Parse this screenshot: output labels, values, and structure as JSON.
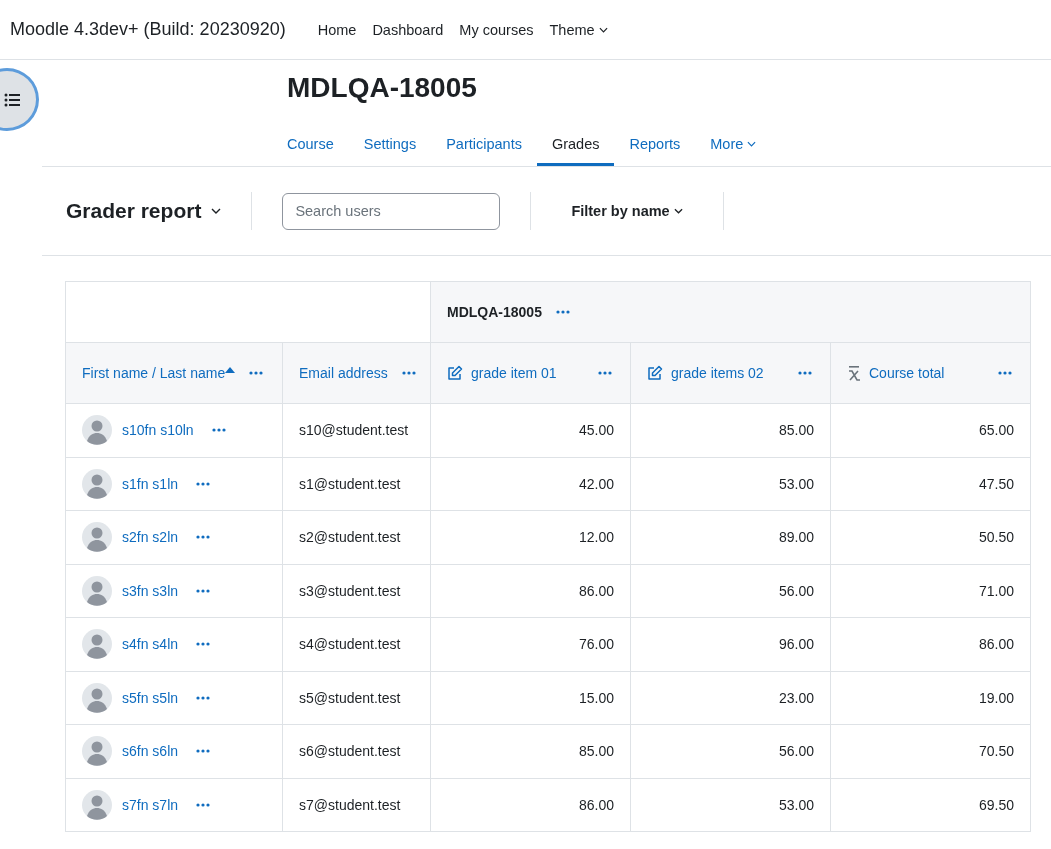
{
  "site_title": "Moodle 4.3dev+ (Build: 20230920)",
  "nav": [
    {
      "label": "Home",
      "dropdown": false
    },
    {
      "label": "Dashboard",
      "dropdown": false
    },
    {
      "label": "My courses",
      "dropdown": false
    },
    {
      "label": "Theme",
      "dropdown": true
    }
  ],
  "course_title": "MDLQA-18005",
  "tabs": [
    {
      "label": "Course",
      "selected": false,
      "dropdown": false
    },
    {
      "label": "Settings",
      "selected": false,
      "dropdown": false
    },
    {
      "label": "Participants",
      "selected": false,
      "dropdown": false
    },
    {
      "label": "Grades",
      "selected": true,
      "dropdown": false
    },
    {
      "label": "Reports",
      "selected": false,
      "dropdown": false
    },
    {
      "label": "More",
      "selected": false,
      "dropdown": true
    }
  ],
  "report_selector": "Grader report",
  "search": {
    "placeholder": "Search users"
  },
  "filter": "Filter by name",
  "table": {
    "category": "MDLQA-18005",
    "columns": [
      {
        "label": "First name / Last name",
        "kind": "name",
        "sorted": true
      },
      {
        "label": "Email address",
        "kind": "email",
        "sorted": false
      },
      {
        "label": "grade item 01",
        "kind": "grade",
        "sorted": false
      },
      {
        "label": "grade items 02",
        "kind": "grade",
        "sorted": false
      },
      {
        "label": "Course total",
        "kind": "total",
        "sorted": false
      }
    ],
    "rows": [
      {
        "name": "s10fn s10ln",
        "email": "s10@student.test",
        "grades": [
          "45.00",
          "85.00",
          "65.00"
        ]
      },
      {
        "name": "s1fn s1ln",
        "email": "s1@student.test",
        "grades": [
          "42.00",
          "53.00",
          "47.50"
        ]
      },
      {
        "name": "s2fn s2ln",
        "email": "s2@student.test",
        "grades": [
          "12.00",
          "89.00",
          "50.50"
        ]
      },
      {
        "name": "s3fn s3ln",
        "email": "s3@student.test",
        "grades": [
          "86.00",
          "56.00",
          "71.00"
        ]
      },
      {
        "name": "s4fn s4ln",
        "email": "s4@student.test",
        "grades": [
          "76.00",
          "96.00",
          "86.00"
        ]
      },
      {
        "name": "s5fn s5ln",
        "email": "s5@student.test",
        "grades": [
          "15.00",
          "23.00",
          "19.00"
        ]
      },
      {
        "name": "s6fn s6ln",
        "email": "s6@student.test",
        "grades": [
          "85.00",
          "56.00",
          "70.50"
        ]
      },
      {
        "name": "s7fn s7ln",
        "email": "s7@student.test",
        "grades": [
          "86.00",
          "53.00",
          "69.50"
        ]
      }
    ]
  }
}
